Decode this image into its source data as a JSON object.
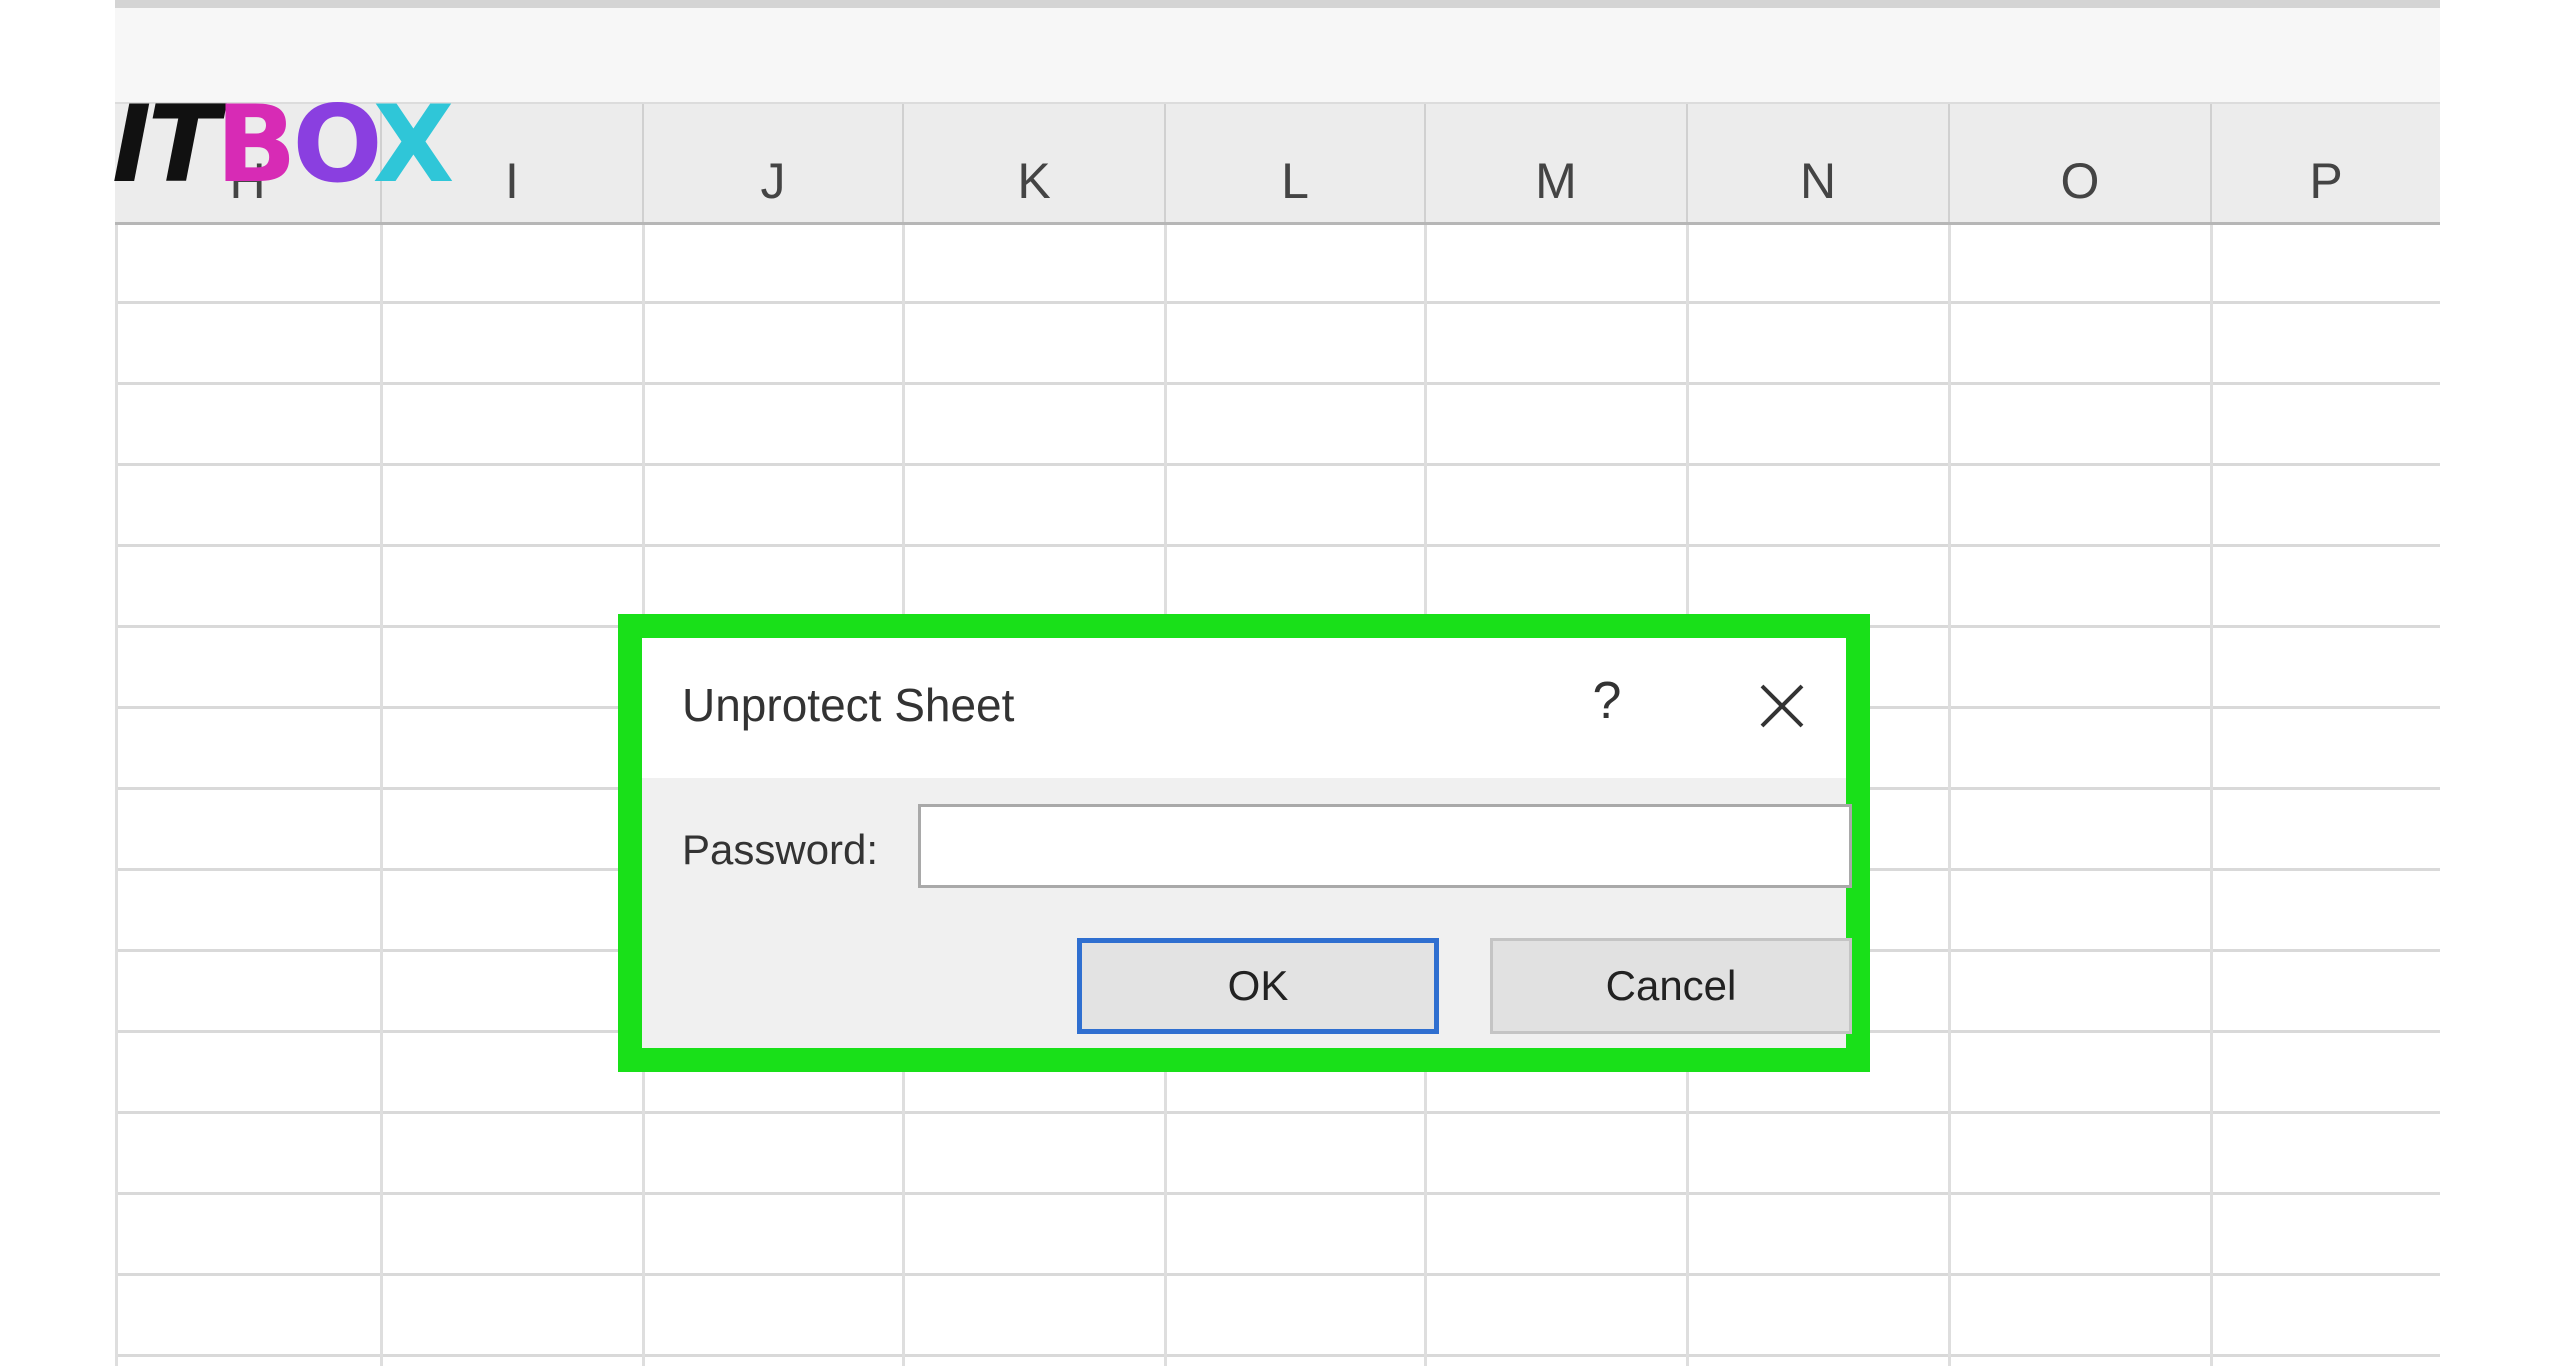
{
  "logo": {
    "part_it": "IT",
    "part_b": "B",
    "part_o": "O",
    "part_x": "X"
  },
  "sheet": {
    "columns": [
      "H",
      "I",
      "J",
      "K",
      "L",
      "M",
      "N",
      "O",
      "P"
    ]
  },
  "dialog": {
    "title": "Unprotect Sheet",
    "help_label": "?",
    "close_icon": "close-icon",
    "password_label": "Password:",
    "password_value": "",
    "ok_label": "OK",
    "cancel_label": "Cancel"
  },
  "colors": {
    "highlight": "#19e019",
    "ok_border": "#2f6fd0"
  }
}
